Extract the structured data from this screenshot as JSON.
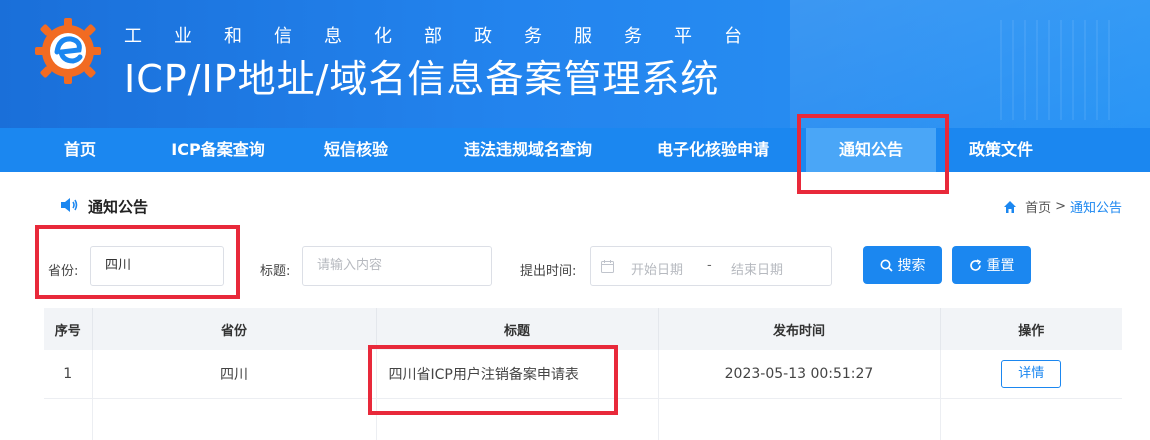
{
  "header": {
    "sub_title": "工业和信息化部政务服务平台",
    "main_title": "ICP/IP地址/域名信息备案管理系统"
  },
  "nav": {
    "items": [
      {
        "label": "首页"
      },
      {
        "label": "ICP备案查询"
      },
      {
        "label": "短信核验"
      },
      {
        "label": "违法违规域名查询"
      },
      {
        "label": "电子化核验申请"
      },
      {
        "label": "通知公告",
        "active": true
      },
      {
        "label": "政策文件"
      }
    ]
  },
  "section": {
    "title": "通知公告",
    "breadcrumb": {
      "home": "首页",
      "separator": ">",
      "current": "通知公告"
    }
  },
  "filters": {
    "province_label": "省份:",
    "province_value": "四川",
    "title_label": "标题:",
    "title_placeholder": "请输入内容",
    "time_label": "提出时间:",
    "start_placeholder": "开始日期",
    "range_separator": "-",
    "end_placeholder": "结束日期",
    "search_label": "搜索",
    "reset_label": "重置"
  },
  "table": {
    "headers": [
      "序号",
      "省份",
      "标题",
      "发布时间",
      "操作"
    ],
    "rows": [
      {
        "index": "1",
        "province": "四川",
        "title": "四川省ICP用户注销备案申请表",
        "time": "2023-05-13 00:51:27",
        "action": "详情"
      }
    ]
  },
  "colors": {
    "accent": "#1b87f0",
    "highlight": "#e8293a"
  }
}
